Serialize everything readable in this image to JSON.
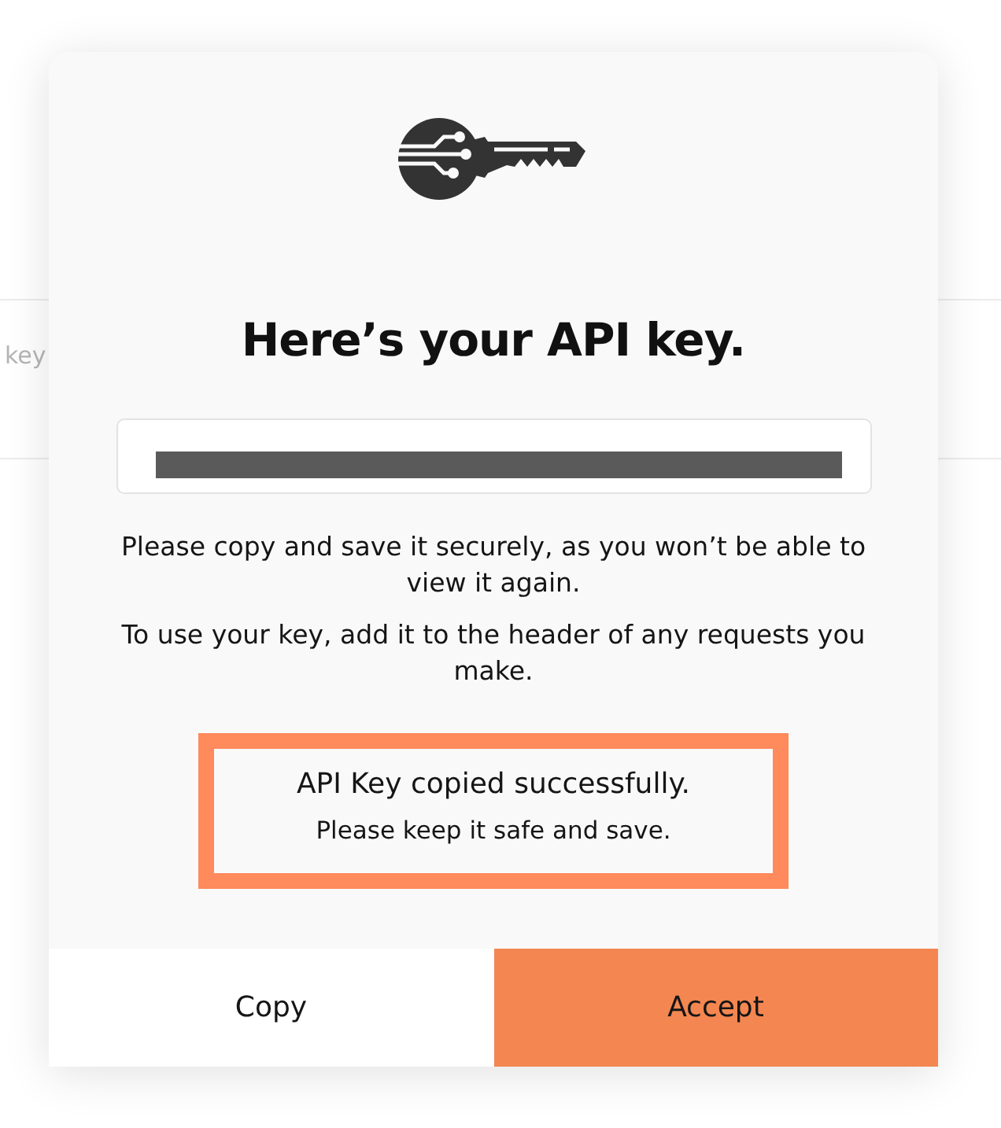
{
  "background": {
    "fragment": "key"
  },
  "dialog": {
    "title": "Here’s your API key.",
    "key_field": {
      "redacted": true
    },
    "paragraphs": [
      "Please copy and save it securely, as you won’t be able to view it again.",
      "To use your key, add it to the header of any requests you make."
    ],
    "notice": {
      "title": "API Key copied successfully.",
      "message": "Please keep it safe and save."
    },
    "buttons": [
      {
        "label": "Copy",
        "kind": "secondary"
      },
      {
        "label": "Accept",
        "kind": "primary"
      }
    ]
  }
}
